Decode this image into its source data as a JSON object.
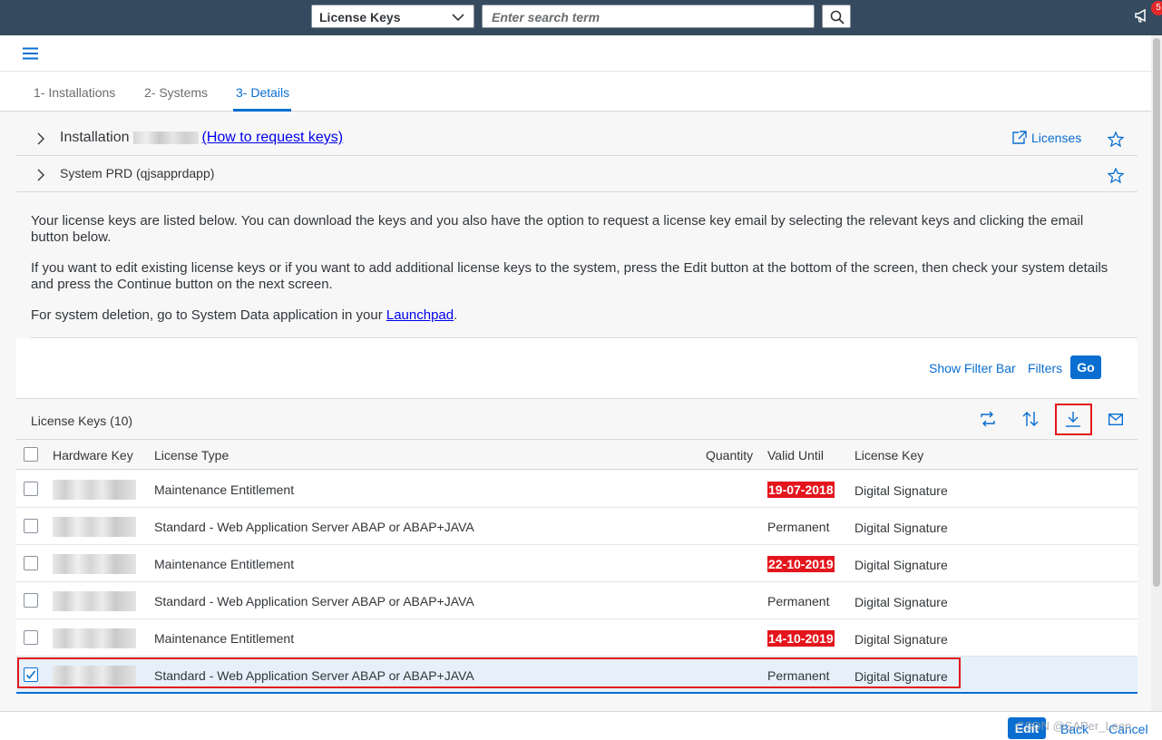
{
  "shell": {
    "scope_label": "License Keys",
    "search_placeholder": "Enter search term",
    "notification_count": "5"
  },
  "tabs": [
    {
      "label": "1- Installations"
    },
    {
      "label": "2- Systems"
    },
    {
      "label": "3- Details"
    }
  ],
  "installation": {
    "prefix": "Installation",
    "link": "(How to request keys)",
    "licenses_link": "Licenses"
  },
  "system": {
    "title": "System PRD (qjsapprdapp)"
  },
  "info": {
    "para1": "Your license keys are listed below. You can download the keys and you also have the option to request a license key email by selecting the relevant keys and clicking the email button below.",
    "para2": "If you want to edit existing license keys or if you want to add additional license keys to the system, press the Edit button at the bottom of the screen, then check your system details and press the Continue button on the next screen.",
    "para3_before": "For system deletion, go to System Data application in your ",
    "para3_link": "Launchpad",
    "para3_after": "."
  },
  "filterbar": {
    "show_filter_bar": "Show Filter Bar",
    "filters": "Filters",
    "go": "Go"
  },
  "table": {
    "title": "License Keys (10)",
    "columns": {
      "hardware_key": "Hardware Key",
      "license_type": "License Type",
      "quantity": "Quantity",
      "valid_until": "Valid Until",
      "license_key": "License Key"
    },
    "rows": [
      {
        "license_type": "Maintenance Entitlement",
        "valid_until": "19-07-2018",
        "expired": true,
        "license_key": "Digital Signature",
        "selected": false
      },
      {
        "license_type": "Standard - Web Application Server ABAP or ABAP+JAVA",
        "valid_until": "Permanent",
        "expired": false,
        "license_key": "Digital Signature",
        "selected": false
      },
      {
        "license_type": "Maintenance Entitlement",
        "valid_until": "22-10-2019",
        "expired": true,
        "license_key": "Digital Signature",
        "selected": false
      },
      {
        "license_type": "Standard - Web Application Server ABAP or ABAP+JAVA",
        "valid_until": "Permanent",
        "expired": false,
        "license_key": "Digital Signature",
        "selected": false
      },
      {
        "license_type": "Maintenance Entitlement",
        "valid_until": "14-10-2019",
        "expired": true,
        "license_key": "Digital Signature",
        "selected": false
      },
      {
        "license_type": "Standard - Web Application Server ABAP or ABAP+JAVA",
        "valid_until": "Permanent",
        "expired": false,
        "license_key": "Digital Signature",
        "selected": true
      }
    ]
  },
  "footer": {
    "edit": "Edit",
    "back": "Back",
    "cancel": "Cancel",
    "watermark": "CSDN @SAPer_Leen"
  },
  "colors": {
    "shell": "#354a5f",
    "accent": "#0a6ed1",
    "highlight": "#e4151c"
  },
  "icons": [
    "search-icon",
    "chevron-down-icon",
    "megaphone-icon",
    "hamburger-icon",
    "chevron-right-icon",
    "star-icon",
    "external-link-icon",
    "refresh-icon",
    "sort-icon",
    "download-icon",
    "email-icon",
    "checkmark-icon"
  ]
}
